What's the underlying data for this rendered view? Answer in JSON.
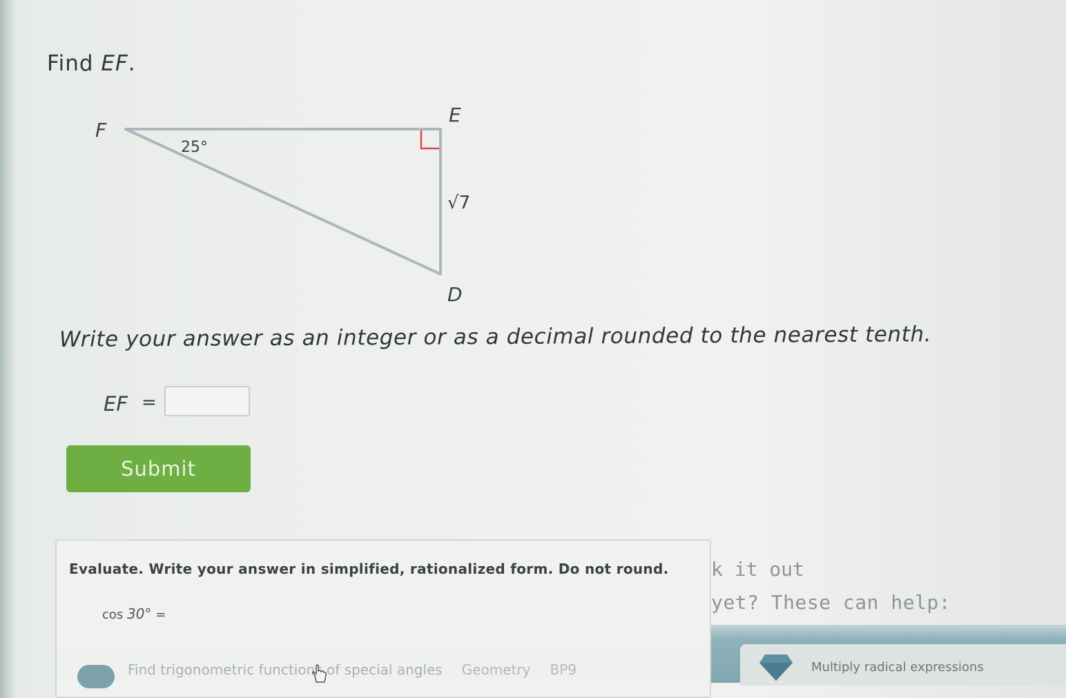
{
  "question": {
    "prompt_prefix": "Find ",
    "prompt_var": "EF",
    "prompt_suffix": "."
  },
  "figure": {
    "vertex_e": "E",
    "vertex_f": "F",
    "vertex_d": "D",
    "angle_label": "25°",
    "side_label": "√7",
    "right_angle_color": "#d94848",
    "line_color": "#aeb6bc"
  },
  "instruction": "Write your answer as an integer or as a decimal rounded to the nearest tenth.",
  "answer": {
    "label": "EF",
    "equals": "=",
    "value": ""
  },
  "submit_label": "Submit",
  "hint_card": {
    "text": "Evaluate. Write your answer in simplified, rationalized form. Do not round.",
    "expression_func": "cos",
    "expression_arg": "30°",
    "expression_equals": "="
  },
  "side_panel": {
    "line1": "k it out",
    "line2": "yet? These can help:"
  },
  "skills": {
    "left_label": "Find trigonometric functions of special angles",
    "left_tag1": "Geometry",
    "left_tag2": "BP9",
    "right_label": "Multiply radical expressions"
  },
  "colors": {
    "accent_green": "#6fae42",
    "card_bg": "#f1f2f0",
    "teal_band": "#8fb2bb"
  },
  "icons": {
    "diamond": "diamond-icon",
    "cursor": "hand-cursor-icon"
  }
}
